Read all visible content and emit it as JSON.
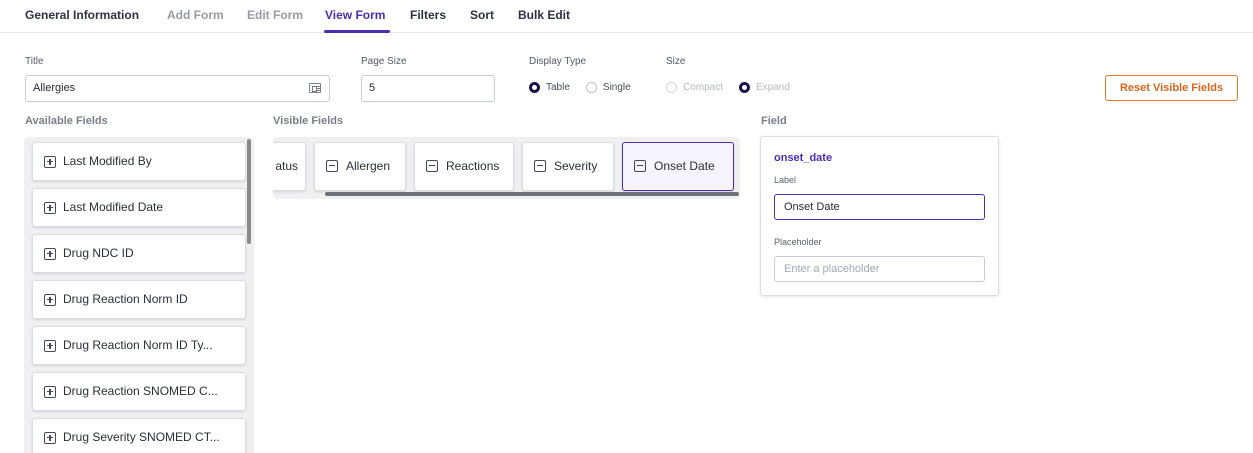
{
  "tabs": [
    {
      "label": "General Information",
      "state": "normal"
    },
    {
      "label": "Add Form",
      "state": "muted"
    },
    {
      "label": "Edit Form",
      "state": "muted"
    },
    {
      "label": "View Form",
      "state": "active"
    },
    {
      "label": "Filters",
      "state": "normal"
    },
    {
      "label": "Sort",
      "state": "normal"
    },
    {
      "label": "Bulk Edit",
      "state": "normal"
    }
  ],
  "form": {
    "title_label": "Title",
    "title_value": "Allergies",
    "page_size_label": "Page Size",
    "page_size_value": "5",
    "display_type_label": "Display Type",
    "display_type_options": [
      "Table",
      "Single"
    ],
    "display_type_selected": "Table",
    "size_label": "Size",
    "size_options": [
      "Compact",
      "Expand"
    ],
    "size_selected": "Expand",
    "reset_button": "Reset Visible Fields"
  },
  "available_fields": {
    "title": "Available Fields",
    "items": [
      "Last Modified By",
      "Last Modified Date",
      "Drug NDC ID",
      "Drug Reaction Norm ID",
      "Drug Reaction Norm ID Ty...",
      "Drug Reaction SNOMED C...",
      "Drug Severity SNOMED CT..."
    ]
  },
  "visible_fields": {
    "title": "Visible Fields",
    "partial_item": "atus",
    "items": [
      "Allergen",
      "Reactions",
      "Severity",
      "Onset Date"
    ],
    "selected": "Onset Date"
  },
  "field_panel": {
    "title": "Field",
    "key": "onset_date",
    "label_label": "Label",
    "label_value": "Onset Date",
    "placeholder_label": "Placeholder",
    "placeholder_hint": "Enter a placeholder"
  },
  "colors": {
    "accent": "#4b2fb2",
    "reset_button": "#d9651d"
  },
  "icons": {
    "add": "plus-square-icon",
    "remove": "minus-square-icon",
    "title_field": "card-icon"
  }
}
